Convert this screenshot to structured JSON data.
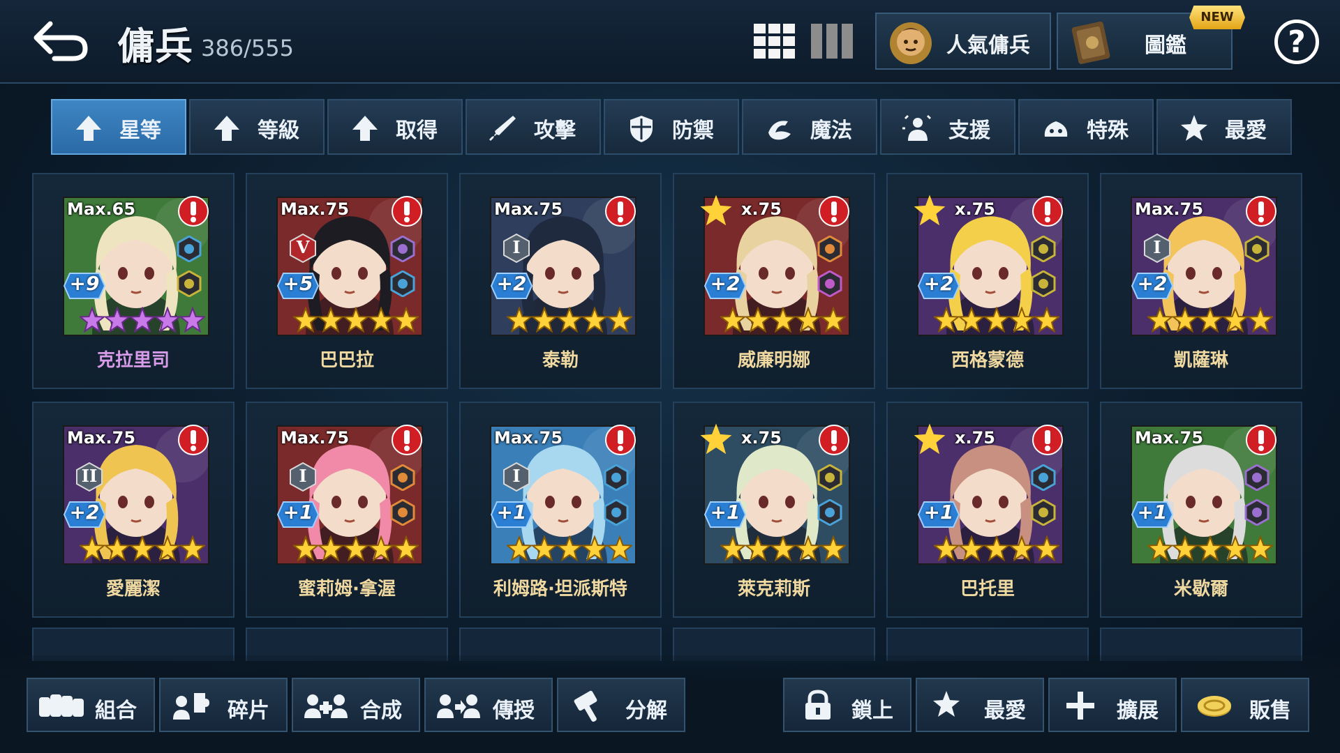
{
  "header": {
    "title": "傭兵",
    "count": "386/555"
  },
  "top_buttons": {
    "popular": "人氣傭兵",
    "dex": "圖鑑",
    "new_badge": "NEW",
    "help": "?"
  },
  "tabs": [
    {
      "label": "星等",
      "icon": "arrow-up-icon",
      "active": true
    },
    {
      "label": "等級",
      "icon": "arrow-up-icon",
      "active": false
    },
    {
      "label": "取得",
      "icon": "arrow-up-icon",
      "active": false
    },
    {
      "label": "攻擊",
      "icon": "sword-icon",
      "active": false
    },
    {
      "label": "防禦",
      "icon": "shield-icon",
      "active": false
    },
    {
      "label": "魔法",
      "icon": "magic-icon",
      "active": false
    },
    {
      "label": "支援",
      "icon": "support-icon",
      "active": false
    },
    {
      "label": "特殊",
      "icon": "special-icon",
      "active": false
    },
    {
      "label": "最愛",
      "icon": "star-icon",
      "active": false
    }
  ],
  "heroes": [
    {
      "name": "克拉里司",
      "max": "Max.65",
      "plus": "+9",
      "rank": "",
      "star_color": "purple",
      "bg": "#3f7a3a",
      "hair": "#efe4c0",
      "fav": false,
      "elems": [
        "#4aa3d8",
        "#c8b43a"
      ]
    },
    {
      "name": "巴巴拉",
      "max": "Max.75",
      "plus": "+5",
      "rank": "V",
      "star_color": "gold",
      "bg": "#7a2a2a",
      "hair": "#1c1c22",
      "fav": false,
      "elems": [
        "#9a6fd0",
        "#4aa3d8"
      ]
    },
    {
      "name": "泰勒",
      "max": "Max.75",
      "plus": "+2",
      "rank": "I",
      "star_color": "gold",
      "bg": "#2e3e5c",
      "hair": "#1f2a3e",
      "fav": false,
      "elems": []
    },
    {
      "name": "威廉明娜",
      "max": "x.75",
      "plus": "+2",
      "rank": "",
      "star_color": "gold",
      "bg": "#7a2a2a",
      "hair": "#e8d2a0",
      "fav": true,
      "elems": [
        "#e08a3a",
        "#c05ac8"
      ]
    },
    {
      "name": "西格蒙德",
      "max": "x.75",
      "plus": "+2",
      "rank": "",
      "star_color": "gold",
      "bg": "#4a2f6a",
      "hair": "#f3cf4a",
      "fav": true,
      "elems": [
        "#c8b43a",
        "#c8b43a"
      ]
    },
    {
      "name": "凱薩琳",
      "max": "Max.75",
      "plus": "+2",
      "rank": "I",
      "star_color": "gold",
      "bg": "#4a2f6a",
      "hair": "#f2c45a",
      "fav": false,
      "elems": [
        "#c8b43a"
      ]
    },
    {
      "name": "愛麗潔",
      "max": "Max.75",
      "plus": "+2",
      "rank": "II",
      "star_color": "gold",
      "bg": "#4a2f6a",
      "hair": "#f0c450",
      "fav": false,
      "elems": []
    },
    {
      "name": "蜜莉姆·拿渥",
      "max": "Max.75",
      "plus": "+1",
      "rank": "I",
      "star_color": "gold",
      "bg": "#7a2a2a",
      "hair": "#f08aa8",
      "fav": false,
      "elems": [
        "#e08a3a",
        "#e08a3a"
      ]
    },
    {
      "name": "利姆路·坦派斯特",
      "max": "Max.75",
      "plus": "+1",
      "rank": "I",
      "star_color": "gold",
      "bg": "#3a7fb8",
      "hair": "#a8d8f0",
      "fav": false,
      "elems": [
        "#4aa3d8",
        "#4aa3d8"
      ]
    },
    {
      "name": "萊克莉斯",
      "max": "x.75",
      "plus": "+1",
      "rank": "",
      "star_color": "gold",
      "bg": "#2e4c62",
      "hair": "#dfe8c8",
      "fav": true,
      "elems": [
        "#c8b43a",
        "#4aa3d8"
      ]
    },
    {
      "name": "巴托里",
      "max": "x.75",
      "plus": "+1",
      "rank": "",
      "star_color": "gold",
      "bg": "#4a2f6a",
      "hair": "#c89080",
      "fav": true,
      "elems": [
        "#4aa3d8",
        "#c8b43a"
      ]
    },
    {
      "name": "米歇爾",
      "max": "Max.75",
      "plus": "+1",
      "rank": "",
      "star_color": "gold",
      "bg": "#3f7a3a",
      "hair": "#dcdcdc",
      "fav": false,
      "elems": [
        "#9a6fd0",
        "#9a6fd0"
      ]
    }
  ],
  "bottom_left": [
    {
      "label": "組合",
      "icon": "combo-icon"
    },
    {
      "label": "碎片",
      "icon": "puzzle-icon"
    },
    {
      "label": "合成",
      "icon": "merge-icon"
    },
    {
      "label": "傳授",
      "icon": "transfer-icon"
    },
    {
      "label": "分解",
      "icon": "hammer-icon"
    }
  ],
  "bottom_right": [
    {
      "label": "鎖上",
      "icon": "lock-icon"
    },
    {
      "label": "最愛",
      "icon": "star-icon"
    },
    {
      "label": "擴展",
      "icon": "plus-icon"
    },
    {
      "label": "販售",
      "icon": "coin-icon"
    }
  ]
}
